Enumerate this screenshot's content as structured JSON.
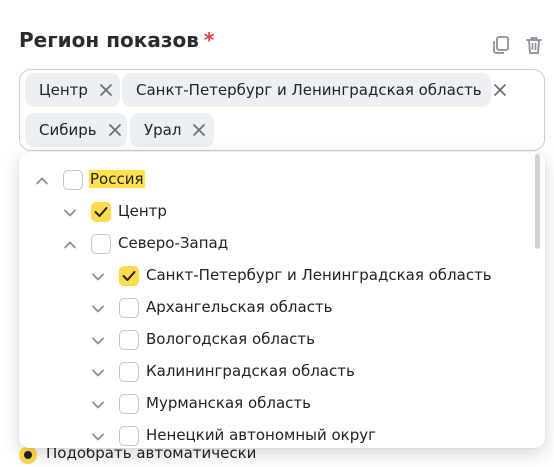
{
  "field": {
    "label": "Регион показов",
    "required_mark": "*"
  },
  "icons": {
    "copy": "copy-icon",
    "trash": "trash-icon",
    "chip_remove": "close-icon",
    "chevron_up": "chevron-up-icon",
    "chevron_down": "chevron-down-icon",
    "check": "check-icon"
  },
  "chips": [
    {
      "label": "Центр"
    },
    {
      "label": "Санкт-Петербург и Ленинградская область"
    },
    {
      "label": "Сибирь"
    },
    {
      "label": "Урал"
    }
  ],
  "tree": [
    {
      "label": "Россия",
      "expanded": true,
      "checked": false,
      "highlighted": true
    },
    {
      "label": "Центр",
      "expanded": false,
      "checked": true,
      "highlighted": false
    },
    {
      "label": "Северо-Запад",
      "expanded": true,
      "checked": false,
      "highlighted": false
    },
    {
      "label": "Санкт-Петербург и Ленинградская область",
      "expanded": false,
      "checked": true,
      "highlighted": false
    },
    {
      "label": "Архангельская область",
      "expanded": false,
      "checked": false,
      "highlighted": false
    },
    {
      "label": "Вологодская область",
      "expanded": false,
      "checked": false,
      "highlighted": false
    },
    {
      "label": "Калининградская область",
      "expanded": false,
      "checked": false,
      "highlighted": false
    },
    {
      "label": "Мурманская область",
      "expanded": false,
      "checked": false,
      "highlighted": false
    },
    {
      "label": "Ненецкий автономный округ",
      "expanded": false,
      "checked": false,
      "highlighted": false
    }
  ],
  "bottom_option": {
    "label": "Подобрать автоматически",
    "selected": true
  },
  "colors": {
    "accent": "#ffdb4d",
    "required": "#e8383d",
    "chip_bg": "#eceff4",
    "border": "#c9ccd3"
  }
}
